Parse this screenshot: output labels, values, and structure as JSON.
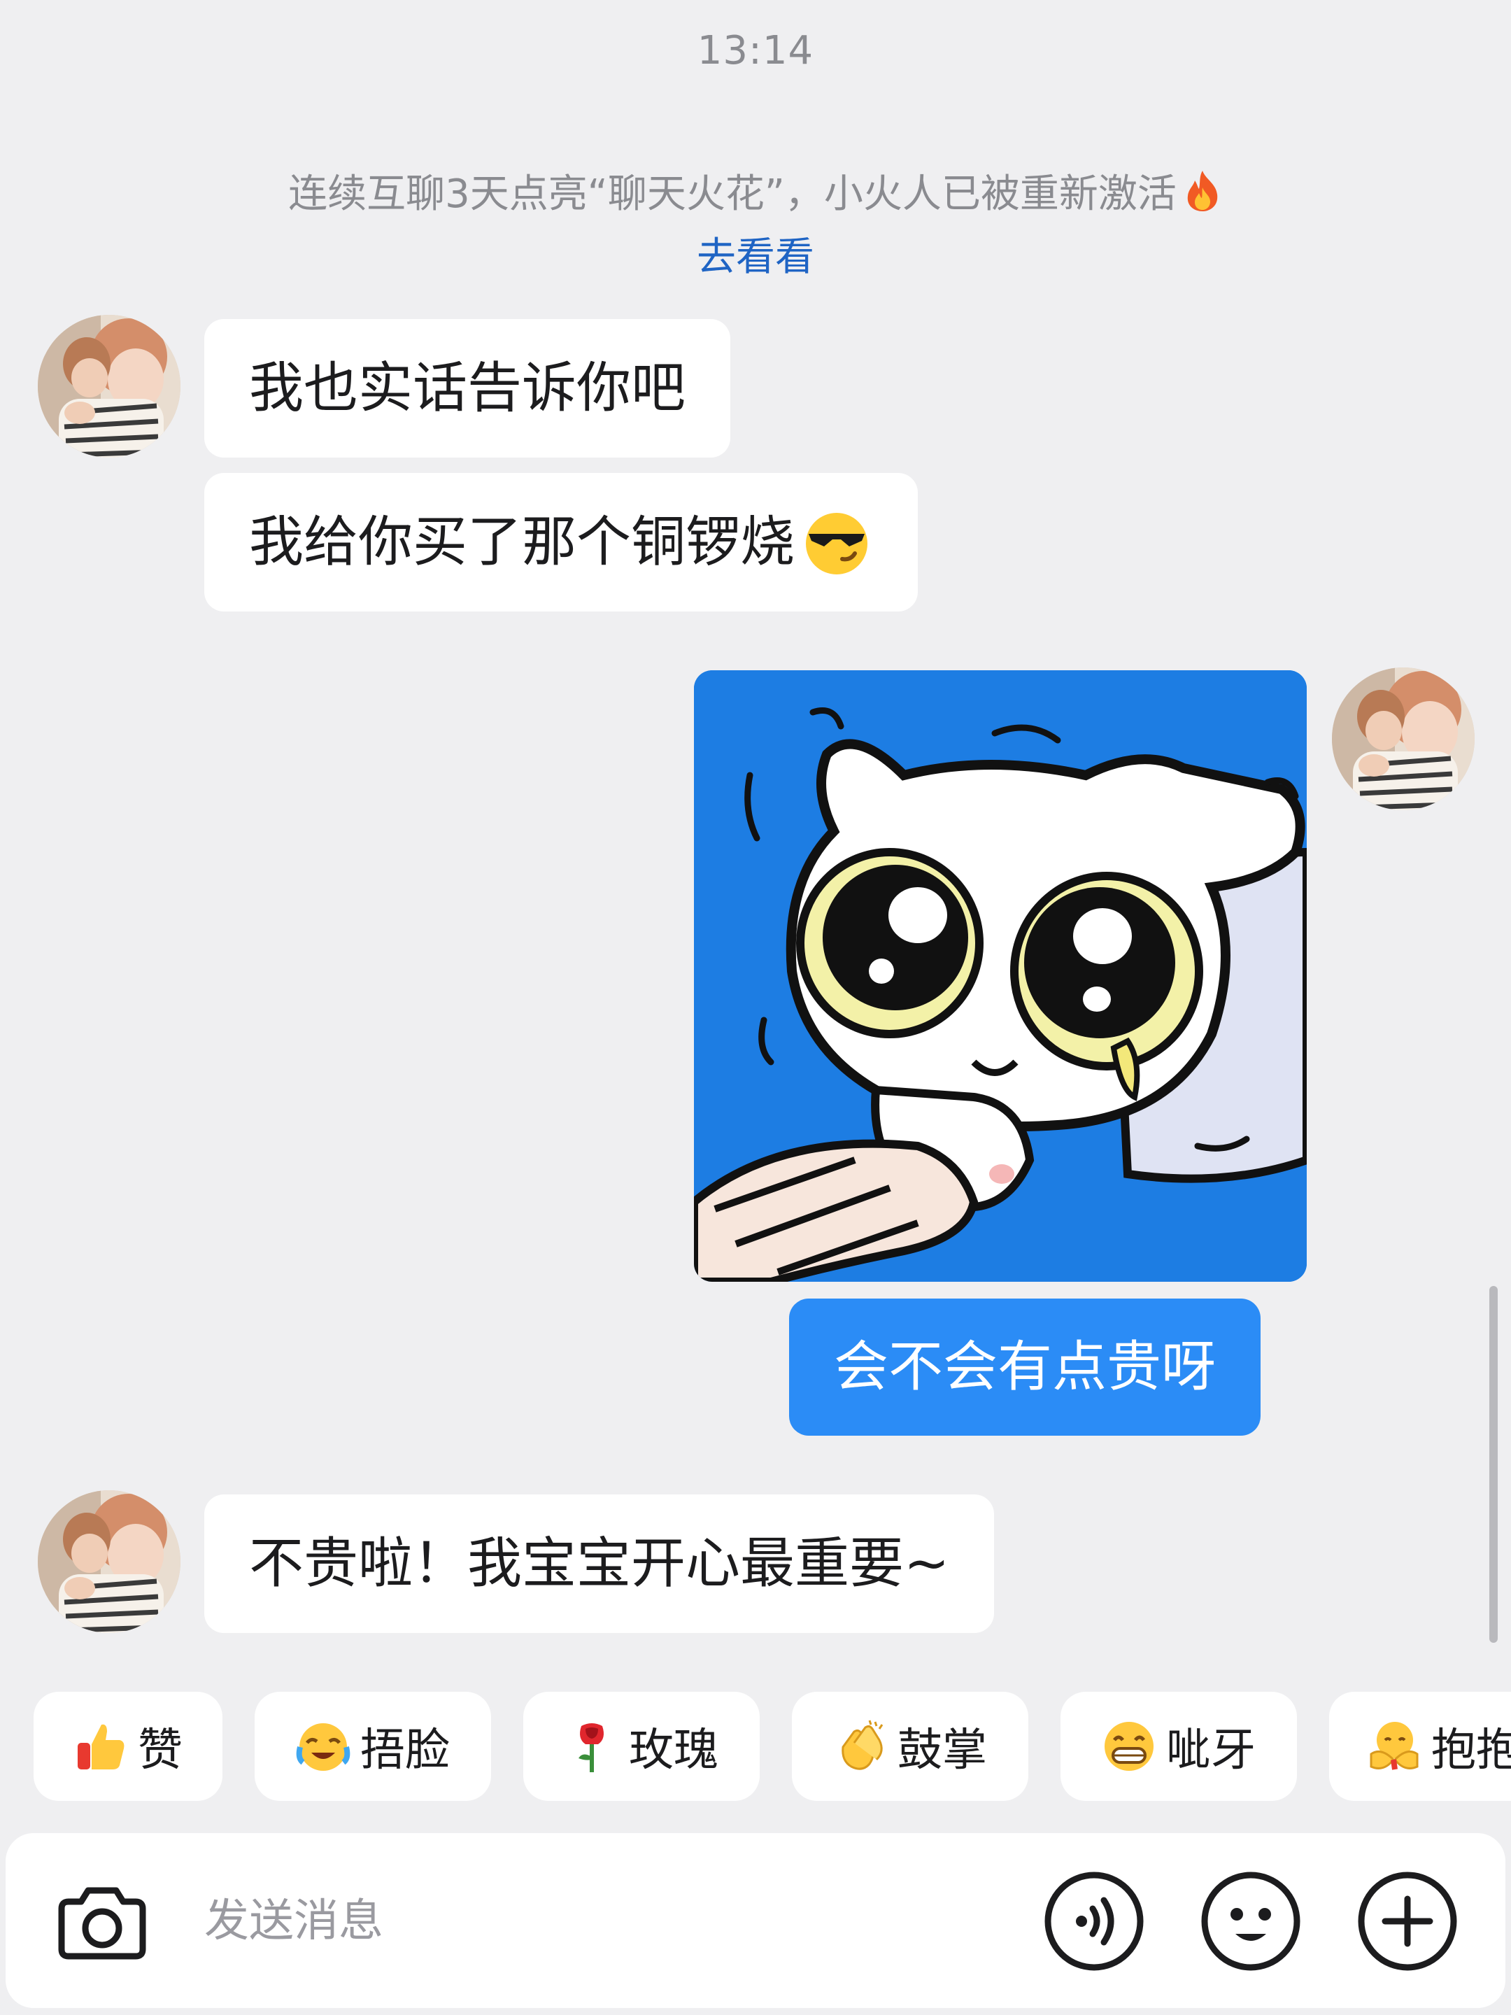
{
  "status": {
    "time": "13:14"
  },
  "system_notice": {
    "text": "连续互聊3天点亮“聊天火花”，小火人已被重新激活",
    "icon": "flame-icon",
    "link_label": "去看看",
    "link_color": "#1f64c4"
  },
  "messages": [
    {
      "side": "incoming",
      "type": "text",
      "text": "我也实话告诉你吧"
    },
    {
      "side": "incoming",
      "type": "text",
      "text": "我给你买了那个铜锣烧",
      "emoji": "sunglasses-emoji"
    },
    {
      "side": "outgoing",
      "type": "sticker",
      "sticker": "crying-cat-sticker"
    },
    {
      "side": "outgoing",
      "type": "text",
      "text": "会不会有点贵呀"
    },
    {
      "side": "incoming",
      "type": "text",
      "text": "不贵啦！我宝宝开心最重要~"
    }
  ],
  "quick_reactions": [
    {
      "label": "赞",
      "icon": "thumbs-up-icon"
    },
    {
      "label": "捂脸",
      "icon": "facepalm-icon"
    },
    {
      "label": "玫瑰",
      "icon": "rose-icon"
    },
    {
      "label": "鼓掌",
      "icon": "clapping-icon"
    },
    {
      "label": "呲牙",
      "icon": "grin-icon"
    },
    {
      "label": "抱抱",
      "icon": "hug-icon"
    }
  ],
  "composer": {
    "placeholder": "发送消息",
    "value": "",
    "icons": [
      "camera-icon",
      "voice-icon",
      "emoji-icon",
      "plus-icon"
    ]
  },
  "colors": {
    "background": "#efeff1",
    "incoming_bubble": "#ffffff",
    "outgoing_bubble": "#2b8cf6",
    "sticker_background": "#1d7de3"
  }
}
